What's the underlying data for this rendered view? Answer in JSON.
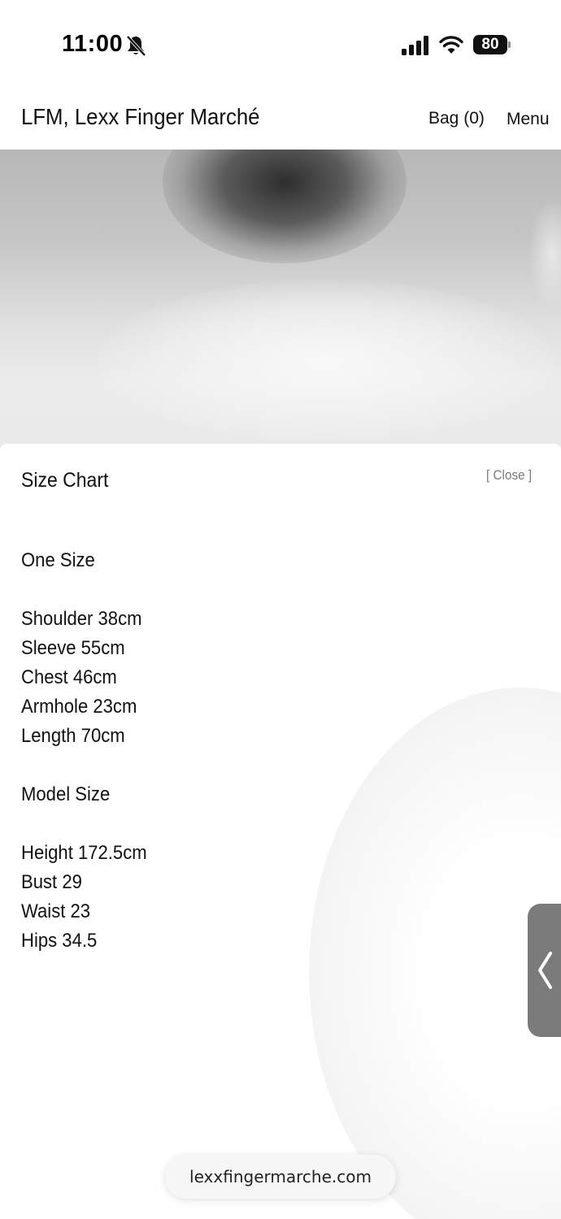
{
  "status_bar": {
    "time": "11:00",
    "battery": "80",
    "icons": [
      "bell-slash-icon",
      "signal-icon",
      "wifi-icon",
      "battery-icon"
    ]
  },
  "header": {
    "title": "LFM, Lexx Finger Marché",
    "bag_label": "Bag (0)",
    "menu_label": "Menu"
  },
  "size_chart": {
    "title": "Size Chart",
    "close_label": "[ Close ]",
    "size_label": "One Size",
    "measurements": [
      "Shoulder 38cm",
      "Sleeve 55cm",
      "Chest 46cm",
      "Armhole 23cm",
      "Length 70cm"
    ],
    "model_heading": "Model Size",
    "model_measurements": [
      "Height 172.5cm",
      "Bust 29",
      "Waist 23",
      "Hips 34.5"
    ]
  },
  "side_handle": {
    "icon": "chevron-left-icon"
  },
  "browser": {
    "url": "lexxfingermarche.com"
  }
}
